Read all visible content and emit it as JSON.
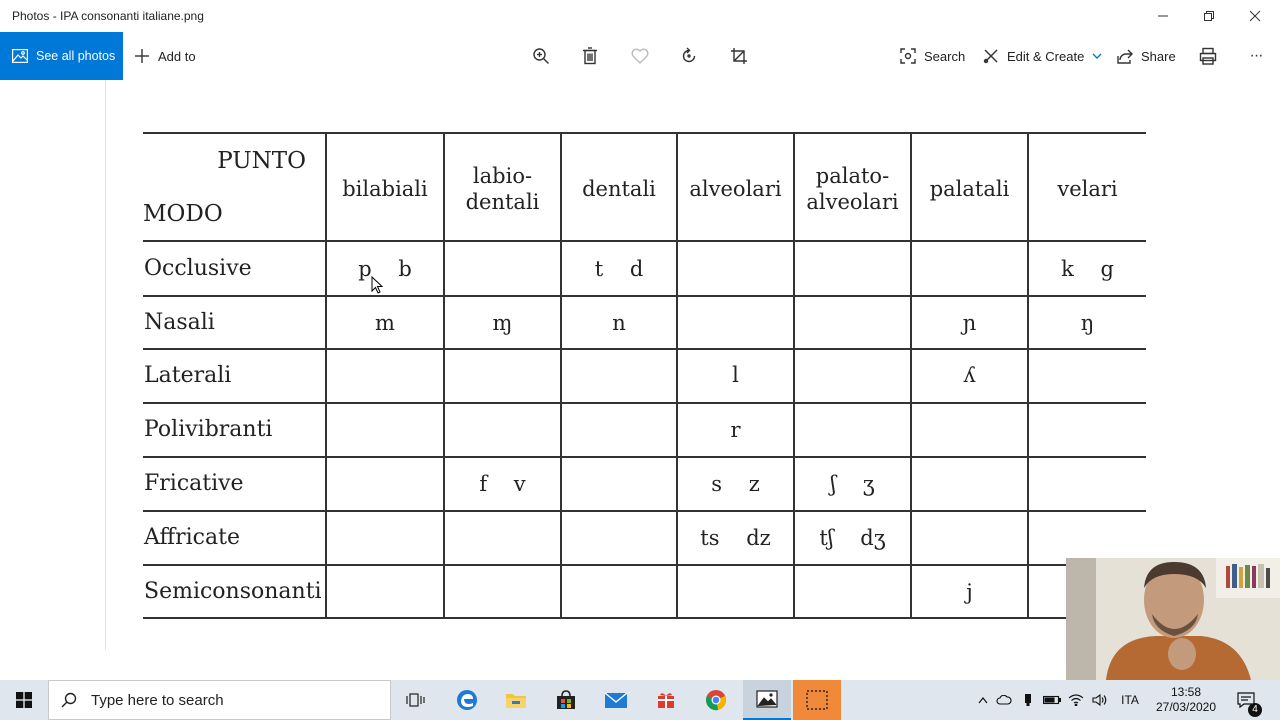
{
  "window": {
    "title": "Photos - IPA consonanti italiane.png"
  },
  "toolbar": {
    "see_all_photos": "See all photos",
    "add_to": "Add to",
    "search": "Search",
    "edit_create": "Edit & Create",
    "share": "Share",
    "more": "···"
  },
  "table": {
    "corner_top": "PUNTO",
    "corner_bottom": "MODO",
    "columns": [
      {
        "line1": "bilabiali",
        "line2": ""
      },
      {
        "line1": "labio-",
        "line2": "dentali"
      },
      {
        "line1": "dentali",
        "line2": ""
      },
      {
        "line1": "alveolari",
        "line2": ""
      },
      {
        "line1": "palato-",
        "line2": "alveolari"
      },
      {
        "line1": "palatali",
        "line2": ""
      },
      {
        "line1": "velari",
        "line2": ""
      }
    ],
    "rows": [
      {
        "label": "Occlusive",
        "cells": [
          "p    b",
          "",
          "t    d",
          "",
          "",
          "",
          "k    g"
        ]
      },
      {
        "label": "Nasali",
        "cells": [
          "m",
          "ɱ",
          "n",
          "",
          "",
          "ɲ",
          "ŋ"
        ]
      },
      {
        "label": "Laterali",
        "cells": [
          "",
          "",
          "",
          "l",
          "",
          "ʎ",
          ""
        ]
      },
      {
        "label": "Polivibranti",
        "cells": [
          "",
          "",
          "",
          "r",
          "",
          "",
          ""
        ]
      },
      {
        "label": "Fricative",
        "cells": [
          "",
          "f    v",
          "",
          "s    z",
          "ʃ    ʒ",
          "",
          ""
        ]
      },
      {
        "label": "Affricate",
        "cells": [
          "",
          "",
          "",
          "ts    dz",
          "tʃ    dʒ",
          "",
          ""
        ]
      },
      {
        "label": "Semiconsonanti",
        "cells": [
          "",
          "",
          "",
          "",
          "",
          "j",
          ""
        ]
      }
    ]
  },
  "taskbar": {
    "search_placeholder": "Type here to search",
    "language": "ITA",
    "time": "13:58",
    "date": "27/03/2020",
    "notification_count": "4"
  },
  "colors": {
    "accent": "#0078d7",
    "taskbar": "#dfe6ee"
  }
}
